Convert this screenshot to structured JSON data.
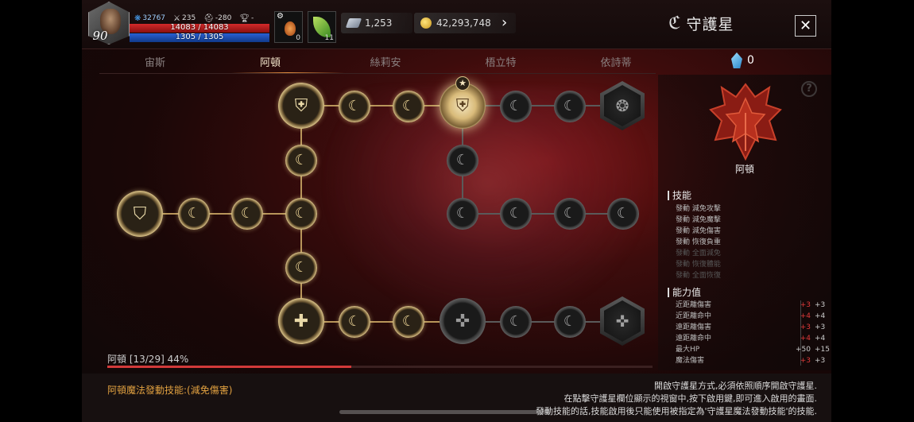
{
  "player": {
    "level": "90",
    "combat_power": "32767",
    "stat_a": "235",
    "stat_b": "-280",
    "rank": "-",
    "hp": "14083 / 14083",
    "mp": "1305 / 1305"
  },
  "slots": [
    {
      "icon": "potion-icon",
      "count": "0"
    },
    {
      "icon": "leaf-icon",
      "count": "11"
    }
  ],
  "currency": {
    "silver": "1,253",
    "gold": "42,293,748"
  },
  "window": {
    "title": "守護星",
    "close_label": "✕"
  },
  "tabs": [
    {
      "label": "宙斯",
      "active": false
    },
    {
      "label": "阿頓",
      "active": true
    },
    {
      "label": "絲莉安",
      "active": false
    },
    {
      "label": "梧立特",
      "active": false
    },
    {
      "label": "依詩蒂",
      "active": false
    }
  ],
  "crystal_count": "0",
  "help_label": "?",
  "panel": {
    "name": "阿頓",
    "skills_title": "技能",
    "skills": [
      {
        "text": "發動 減免攻擊",
        "enabled": true
      },
      {
        "text": "發動 減免魔擊",
        "enabled": true
      },
      {
        "text": "發動 減免傷害",
        "enabled": true
      },
      {
        "text": "發動 恢復負重",
        "enabled": true
      },
      {
        "text": "發動 全面減免",
        "enabled": false
      },
      {
        "text": "發動 恢復體能",
        "enabled": false
      },
      {
        "text": "發動 全面恢復",
        "enabled": false
      }
    ],
    "attrs_title": "能力值",
    "attrs": [
      {
        "name": "近距離傷害",
        "v1": "+3",
        "v1_red": true,
        "v2": "+3"
      },
      {
        "name": "近距離命中",
        "v1": "+4",
        "v1_red": true,
        "v2": "+4"
      },
      {
        "name": "遠距離傷害",
        "v1": "+3",
        "v1_red": true,
        "v2": "+3"
      },
      {
        "name": "遠距離命中",
        "v1": "+4",
        "v1_red": true,
        "v2": "+4"
      },
      {
        "name": "最大HP",
        "v1": "+50",
        "v1_red": false,
        "v2": "+15"
      },
      {
        "name": "魔法傷害",
        "v1": "+3",
        "v1_red": true,
        "v2": "+3"
      }
    ]
  },
  "progress": {
    "label": "阿頓 [13/29] 44%",
    "fraction": 0.448
  },
  "footer": {
    "left": "阿頓魔法發動技能:(減免傷害)",
    "right_lines": [
      "開啟守護星方式,必須依照順序開啟守護星.",
      "在點擊守護星欄位顯示的視窗中,按下啟用鍵,即可進入啟用的畫面.",
      "發動技能的話,技能啟用後只能使用被指定為'守護星魔法發動技能'的技能."
    ]
  }
}
